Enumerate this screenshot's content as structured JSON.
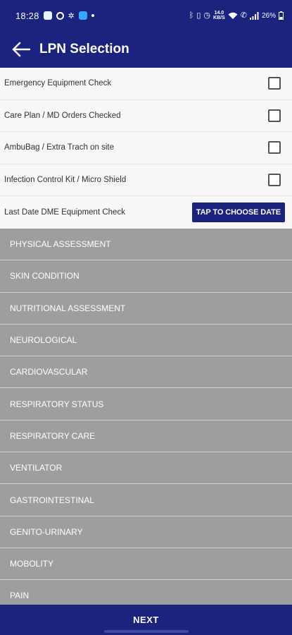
{
  "status_bar": {
    "time": "18:28",
    "left_icons": [
      "message-icon",
      "circle-app-icon",
      "gear-icon",
      "blue-app-icon",
      "dot-icon"
    ],
    "right_icons": [
      "bluetooth-icon",
      "vibrate-icon",
      "alarm-icon",
      "wifi-icon",
      "call-icon",
      "signal-icon"
    ],
    "speed_top": "14.0",
    "speed_bottom": "KB/S",
    "battery": "26%"
  },
  "app_bar": {
    "title": "LPN Selection"
  },
  "checklist": [
    {
      "label": "Emergency Equipment Check",
      "checked": false
    },
    {
      "label": "Care Plan / MD Orders Checked",
      "checked": false
    },
    {
      "label": "AmbuBag / Extra Trach on site",
      "checked": false
    },
    {
      "label": "Infection Control Kit / Micro Shield",
      "checked": false
    }
  ],
  "date_row": {
    "label": "Last Date DME Equipment Check",
    "button_label": "TAP TO CHOOSE DATE"
  },
  "sections": [
    "PHYSICAL ASSESSMENT",
    "SKIN CONDITION",
    "NUTRITIONAL ASSESSMENT",
    "NEUROLOGICAL",
    "CARDIOVASCULAR",
    "RESPIRATORY STATUS",
    "RESPIRATORY CARE",
    "VENTILATOR",
    "GASTROINTESTINAL",
    "GENITO-URINARY",
    "MOBOLITY",
    "PAIN"
  ],
  "next_label": "NEXT",
  "colors": {
    "primary": "#1a237e",
    "section_bg": "#9e9e9e"
  }
}
